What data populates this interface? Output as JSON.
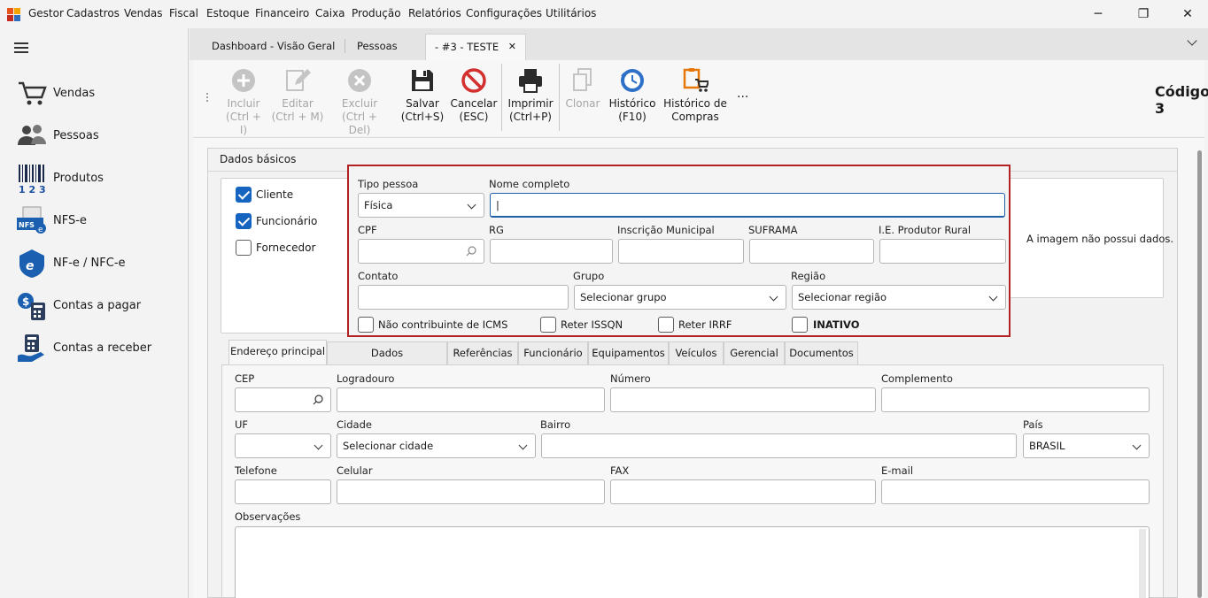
{
  "menubar": {
    "app": "Gestor",
    "items": [
      "Cadastros",
      "Vendas",
      "Fiscal",
      "Estoque",
      "Financeiro",
      "Caixa",
      "Produção",
      "Relatórios",
      "Configurações",
      "Utilitários"
    ]
  },
  "sidebar": {
    "items": [
      {
        "label": "Vendas",
        "icon": "cart-icon"
      },
      {
        "label": "Pessoas",
        "icon": "people-icon"
      },
      {
        "label": "Produtos",
        "icon": "barcode-icon"
      },
      {
        "label": "NFS-e",
        "icon": "nfse-icon"
      },
      {
        "label": "NF-e / NFC-e",
        "icon": "nfe-icon"
      },
      {
        "label": "Contas a pagar",
        "icon": "bills-pay-icon"
      },
      {
        "label": "Contas a receber",
        "icon": "bills-receive-icon"
      }
    ]
  },
  "doc_tabs": [
    {
      "label": "Dashboard - Visão Geral"
    },
    {
      "label": "Pessoas"
    },
    {
      "label": "- #3 - TESTE",
      "close": "✕"
    }
  ],
  "toolbar": {
    "incluir": {
      "l1": "Incluir",
      "l2": "(Ctrl + I)"
    },
    "editar": {
      "l1": "Editar",
      "l2": "(Ctrl + M)"
    },
    "excluir": {
      "l1": "Excluir",
      "l2": "(Ctrl + Del)"
    },
    "salvar": {
      "l1": "Salvar",
      "l2": "(Ctrl+S)"
    },
    "cancelar": {
      "l1": "Cancelar",
      "l2": "(ESC)"
    },
    "imprimir": {
      "l1": "Imprimir",
      "l2": "(Ctrl+P)"
    },
    "clonar": {
      "l1": "Clonar"
    },
    "historico": {
      "l1": "Histórico",
      "l2": "(F10)"
    },
    "hist_compras": {
      "l1": "Histórico de",
      "l2": "Compras"
    },
    "more": "...",
    "codigo_label": "Código",
    "codigo_value": "3"
  },
  "panel": {
    "title": "Dados básicos",
    "image_msg": "A imagem não possui dados."
  },
  "roles": {
    "cliente": "Cliente",
    "funcionario": "Funcionário",
    "fornecedor": "Fornecedor"
  },
  "form": {
    "tipo_pessoa": {
      "label": "Tipo pessoa",
      "value": "Física"
    },
    "nome": {
      "label": "Nome completo",
      "value": "|"
    },
    "cpf": {
      "label": "CPF"
    },
    "rg": {
      "label": "RG"
    },
    "im": {
      "label": "Inscrição Municipal"
    },
    "suframa": {
      "label": "SUFRAMA"
    },
    "ie": {
      "label": "I.E. Produtor Rural"
    },
    "contato": {
      "label": "Contato"
    },
    "grupo": {
      "label": "Grupo",
      "value": "Selecionar grupo"
    },
    "regiao": {
      "label": "Região",
      "value": "Selecionar região"
    },
    "icms": "Não contribuinte de ICMS",
    "issqn": "Reter ISSQN",
    "irrf": "Reter IRRF",
    "inativo": "INATIVO"
  },
  "subtabs": [
    "Endereço principal",
    "Dados complementares",
    "Referências",
    "Funcionário",
    "Equipamentos",
    "Veículos",
    "Gerencial",
    "Documentos"
  ],
  "address": {
    "cep": "CEP",
    "logradouro": "Logradouro",
    "numero": "Número",
    "complemento": "Complemento",
    "uf": "UF",
    "cidade": "Cidade",
    "cidade_value": "Selecionar cidade",
    "bairro": "Bairro",
    "pais": "País",
    "pais_value": "BRASIL",
    "telefone": "Telefone",
    "celular": "Celular",
    "fax": "FAX",
    "email": "E-mail",
    "obs": "Observações"
  }
}
